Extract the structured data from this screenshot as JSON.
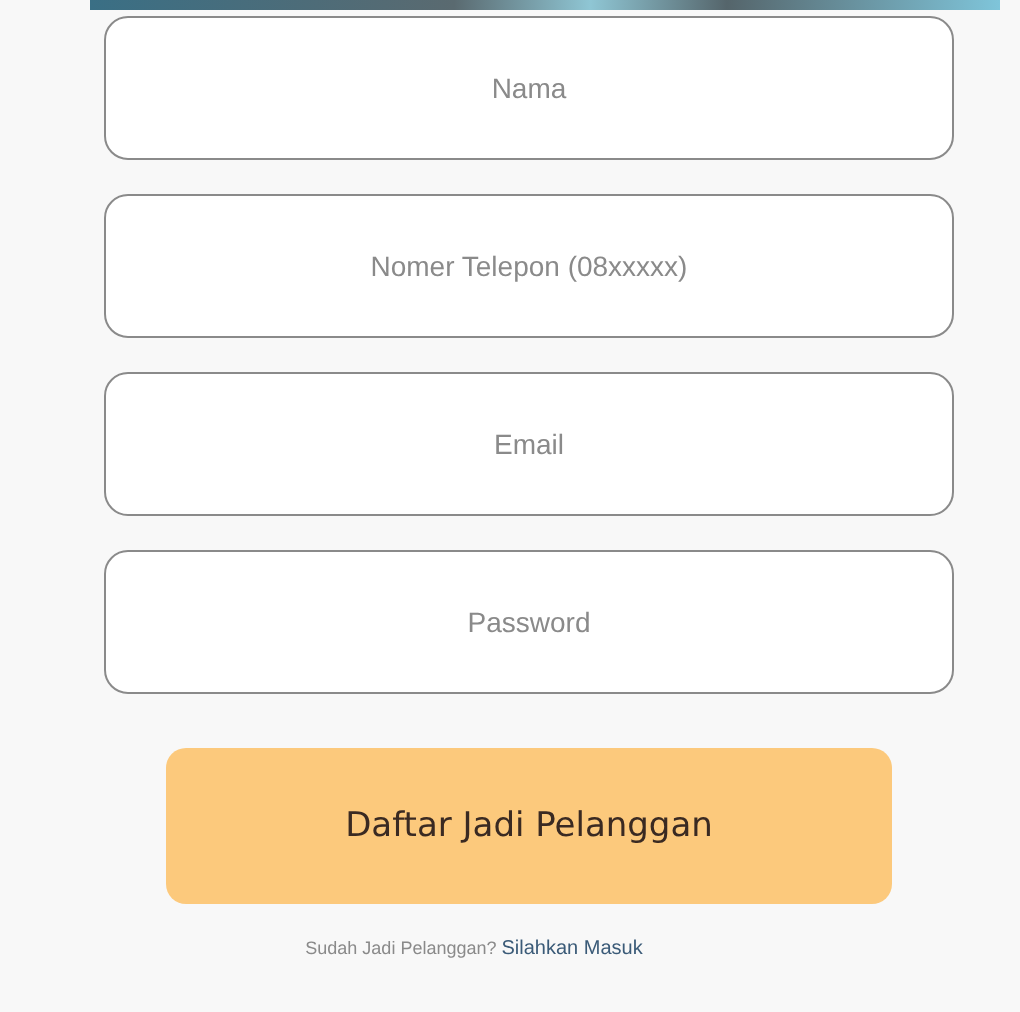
{
  "fields": [
    {
      "placeholder": "Nama"
    },
    {
      "placeholder": "Nomer Telepon (08xxxxx)"
    },
    {
      "placeholder": "Email"
    },
    {
      "placeholder": "Password"
    }
  ],
  "submit_button": {
    "label": "Daftar Jadi Pelanggan"
  },
  "footer": {
    "text": "Sudah Jadi Pelanggan?",
    "link": "Silahkan Masuk"
  }
}
